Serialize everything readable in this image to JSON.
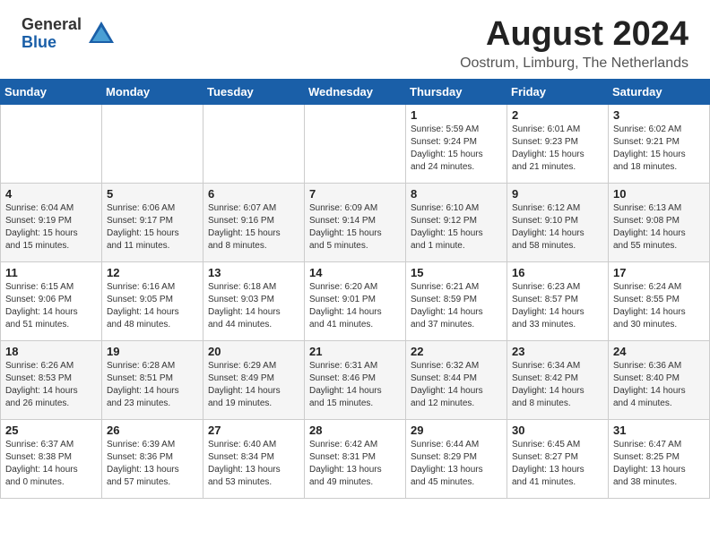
{
  "header": {
    "logo_general": "General",
    "logo_blue": "Blue",
    "month_title": "August 2024",
    "location": "Oostrum, Limburg, The Netherlands"
  },
  "weekdays": [
    "Sunday",
    "Monday",
    "Tuesday",
    "Wednesday",
    "Thursday",
    "Friday",
    "Saturday"
  ],
  "weeks": [
    [
      {
        "day": "",
        "info": ""
      },
      {
        "day": "",
        "info": ""
      },
      {
        "day": "",
        "info": ""
      },
      {
        "day": "",
        "info": ""
      },
      {
        "day": "1",
        "info": "Sunrise: 5:59 AM\nSunset: 9:24 PM\nDaylight: 15 hours\nand 24 minutes."
      },
      {
        "day": "2",
        "info": "Sunrise: 6:01 AM\nSunset: 9:23 PM\nDaylight: 15 hours\nand 21 minutes."
      },
      {
        "day": "3",
        "info": "Sunrise: 6:02 AM\nSunset: 9:21 PM\nDaylight: 15 hours\nand 18 minutes."
      }
    ],
    [
      {
        "day": "4",
        "info": "Sunrise: 6:04 AM\nSunset: 9:19 PM\nDaylight: 15 hours\nand 15 minutes."
      },
      {
        "day": "5",
        "info": "Sunrise: 6:06 AM\nSunset: 9:17 PM\nDaylight: 15 hours\nand 11 minutes."
      },
      {
        "day": "6",
        "info": "Sunrise: 6:07 AM\nSunset: 9:16 PM\nDaylight: 15 hours\nand 8 minutes."
      },
      {
        "day": "7",
        "info": "Sunrise: 6:09 AM\nSunset: 9:14 PM\nDaylight: 15 hours\nand 5 minutes."
      },
      {
        "day": "8",
        "info": "Sunrise: 6:10 AM\nSunset: 9:12 PM\nDaylight: 15 hours\nand 1 minute."
      },
      {
        "day": "9",
        "info": "Sunrise: 6:12 AM\nSunset: 9:10 PM\nDaylight: 14 hours\nand 58 minutes."
      },
      {
        "day": "10",
        "info": "Sunrise: 6:13 AM\nSunset: 9:08 PM\nDaylight: 14 hours\nand 55 minutes."
      }
    ],
    [
      {
        "day": "11",
        "info": "Sunrise: 6:15 AM\nSunset: 9:06 PM\nDaylight: 14 hours\nand 51 minutes."
      },
      {
        "day": "12",
        "info": "Sunrise: 6:16 AM\nSunset: 9:05 PM\nDaylight: 14 hours\nand 48 minutes."
      },
      {
        "day": "13",
        "info": "Sunrise: 6:18 AM\nSunset: 9:03 PM\nDaylight: 14 hours\nand 44 minutes."
      },
      {
        "day": "14",
        "info": "Sunrise: 6:20 AM\nSunset: 9:01 PM\nDaylight: 14 hours\nand 41 minutes."
      },
      {
        "day": "15",
        "info": "Sunrise: 6:21 AM\nSunset: 8:59 PM\nDaylight: 14 hours\nand 37 minutes."
      },
      {
        "day": "16",
        "info": "Sunrise: 6:23 AM\nSunset: 8:57 PM\nDaylight: 14 hours\nand 33 minutes."
      },
      {
        "day": "17",
        "info": "Sunrise: 6:24 AM\nSunset: 8:55 PM\nDaylight: 14 hours\nand 30 minutes."
      }
    ],
    [
      {
        "day": "18",
        "info": "Sunrise: 6:26 AM\nSunset: 8:53 PM\nDaylight: 14 hours\nand 26 minutes."
      },
      {
        "day": "19",
        "info": "Sunrise: 6:28 AM\nSunset: 8:51 PM\nDaylight: 14 hours\nand 23 minutes."
      },
      {
        "day": "20",
        "info": "Sunrise: 6:29 AM\nSunset: 8:49 PM\nDaylight: 14 hours\nand 19 minutes."
      },
      {
        "day": "21",
        "info": "Sunrise: 6:31 AM\nSunset: 8:46 PM\nDaylight: 14 hours\nand 15 minutes."
      },
      {
        "day": "22",
        "info": "Sunrise: 6:32 AM\nSunset: 8:44 PM\nDaylight: 14 hours\nand 12 minutes."
      },
      {
        "day": "23",
        "info": "Sunrise: 6:34 AM\nSunset: 8:42 PM\nDaylight: 14 hours\nand 8 minutes."
      },
      {
        "day": "24",
        "info": "Sunrise: 6:36 AM\nSunset: 8:40 PM\nDaylight: 14 hours\nand 4 minutes."
      }
    ],
    [
      {
        "day": "25",
        "info": "Sunrise: 6:37 AM\nSunset: 8:38 PM\nDaylight: 14 hours\nand 0 minutes."
      },
      {
        "day": "26",
        "info": "Sunrise: 6:39 AM\nSunset: 8:36 PM\nDaylight: 13 hours\nand 57 minutes."
      },
      {
        "day": "27",
        "info": "Sunrise: 6:40 AM\nSunset: 8:34 PM\nDaylight: 13 hours\nand 53 minutes."
      },
      {
        "day": "28",
        "info": "Sunrise: 6:42 AM\nSunset: 8:31 PM\nDaylight: 13 hours\nand 49 minutes."
      },
      {
        "day": "29",
        "info": "Sunrise: 6:44 AM\nSunset: 8:29 PM\nDaylight: 13 hours\nand 45 minutes."
      },
      {
        "day": "30",
        "info": "Sunrise: 6:45 AM\nSunset: 8:27 PM\nDaylight: 13 hours\nand 41 minutes."
      },
      {
        "day": "31",
        "info": "Sunrise: 6:47 AM\nSunset: 8:25 PM\nDaylight: 13 hours\nand 38 minutes."
      }
    ]
  ]
}
